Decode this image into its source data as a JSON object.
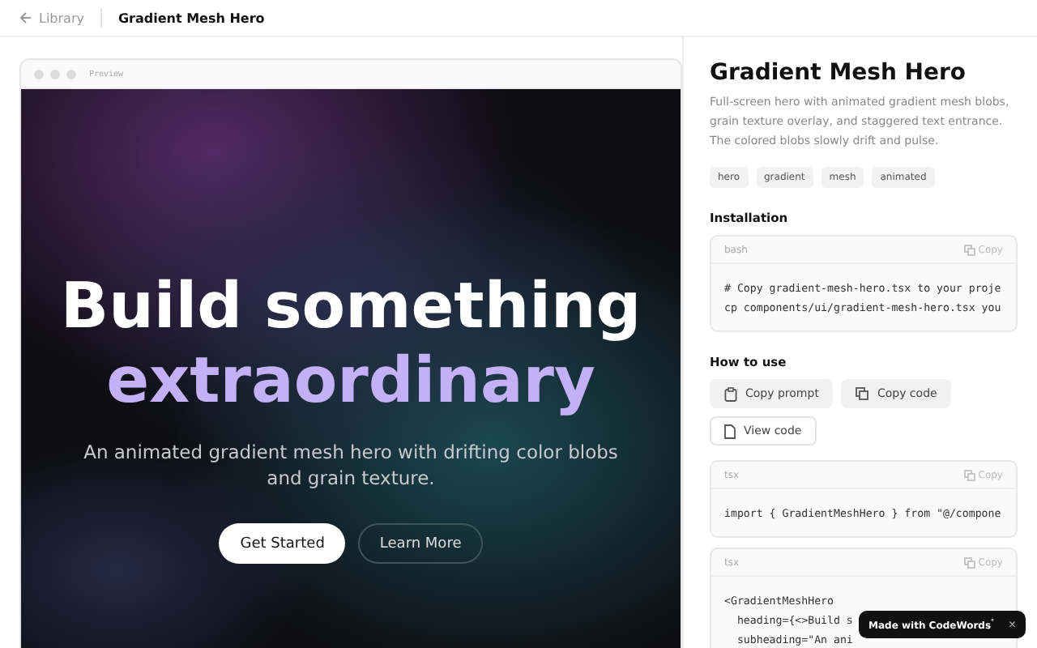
{
  "topbar": {
    "back": "Library",
    "title": "Gradient Mesh Hero"
  },
  "preview": {
    "label": "Preview",
    "heading": "Build something",
    "heading_accent": "extraordinary",
    "subheading": "An animated gradient mesh hero with drifting color blobs and grain texture.",
    "buttons": [
      {
        "label": "Get Started",
        "kind": "primary"
      },
      {
        "label": "Learn More",
        "kind": "outline"
      }
    ]
  },
  "details": {
    "title": "Gradient Mesh Hero",
    "description": "Full-screen hero with animated gradient mesh blobs, grain texture overlay, and staggered text entrance. The colored blobs slowly drift and pulse.",
    "tags": [
      "hero",
      "gradient",
      "mesh",
      "animated"
    ],
    "installation": {
      "heading": "Installation",
      "block": {
        "lang": "bash",
        "copy": "Copy",
        "lines": [
          "# Copy gradient-mesh-hero.tsx to your proje",
          "cp components/ui/gradient-mesh-hero.tsx you"
        ]
      }
    },
    "usage": {
      "heading": "How to use",
      "actions": [
        {
          "label": "Copy prompt",
          "kind": "clipboard"
        },
        {
          "label": "Copy code",
          "kind": "copy"
        },
        {
          "label": "View code",
          "kind": "file"
        }
      ],
      "blocks": [
        {
          "lang": "tsx",
          "copy": "Copy",
          "lines": [
            "import { GradientMeshHero } from \"@/compone"
          ]
        },
        {
          "lang": "tsx",
          "copy": "Copy",
          "lines": [
            "<GradientMeshHero",
            "  heading={<>Build s",
            "  subheading=\"An ani"
          ]
        }
      ]
    }
  },
  "toast": {
    "text": "Made with CodeWords",
    "mark": "°",
    "close": "×"
  }
}
